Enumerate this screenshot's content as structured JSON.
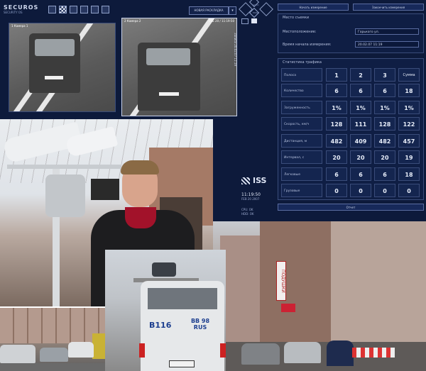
{
  "app": {
    "logo": "SECUROS",
    "logo_sub": "SECURITY OS",
    "top_combo": "НОВАЯ РАСКЛАДКА",
    "auto_label": "AUTO",
    "mode_label": "MODE",
    "camera1": {
      "label": "1 Камера 1",
      "plate": "А 150 ММ"
    },
    "camera2": {
      "label": "2 Камера 2",
      "stamp": "PSE 20 / 11:19:50",
      "plate": "Х 210 АВ"
    },
    "camera2_side": "Записи 20.02.07 11:19",
    "reset_button": "Начать измерение",
    "finish_button": "Закончить измерения",
    "location_panel": {
      "title": "Место съемки",
      "location_label": "Местоположение:",
      "location_value": "Горького ул.",
      "time_label": "Время начала измерения:",
      "time_value": "20.02.07 11:19"
    },
    "stats_panel": {
      "title": "Статистика трафика",
      "header_label": "Полоса",
      "columns": [
        "1",
        "2",
        "3",
        "Сумма"
      ],
      "rows": [
        {
          "label": "Количество",
          "values": [
            "6",
            "6",
            "6",
            "18"
          ]
        },
        {
          "label": "Загруженность",
          "values": [
            "1%",
            "1%",
            "1%",
            "1%"
          ]
        },
        {
          "label": "Скорость, км/ч",
          "values": [
            "128",
            "111",
            "128",
            "122"
          ]
        },
        {
          "label": "Дистанция, м",
          "values": [
            "482",
            "409",
            "482",
            "457"
          ]
        },
        {
          "label": "Интервал, с",
          "values": [
            "20",
            "20",
            "20",
            "19"
          ]
        },
        {
          "label": "Легковые",
          "values": [
            "6",
            "6",
            "6",
            "18"
          ]
        },
        {
          "label": "Грузовые",
          "values": [
            "0",
            "0",
            "0",
            "0"
          ]
        }
      ]
    },
    "report_button": "Отчет",
    "brand": "ISS",
    "clock": "11:19:50",
    "date": "FEB 20 2007",
    "cpu": "CPU: OK",
    "hdd": "HDD: OK"
  },
  "photos": {
    "van_sign_left": "B116",
    "van_sign_right": "BB 98 RUS",
    "building_sign": "ПОДУШКИ"
  }
}
